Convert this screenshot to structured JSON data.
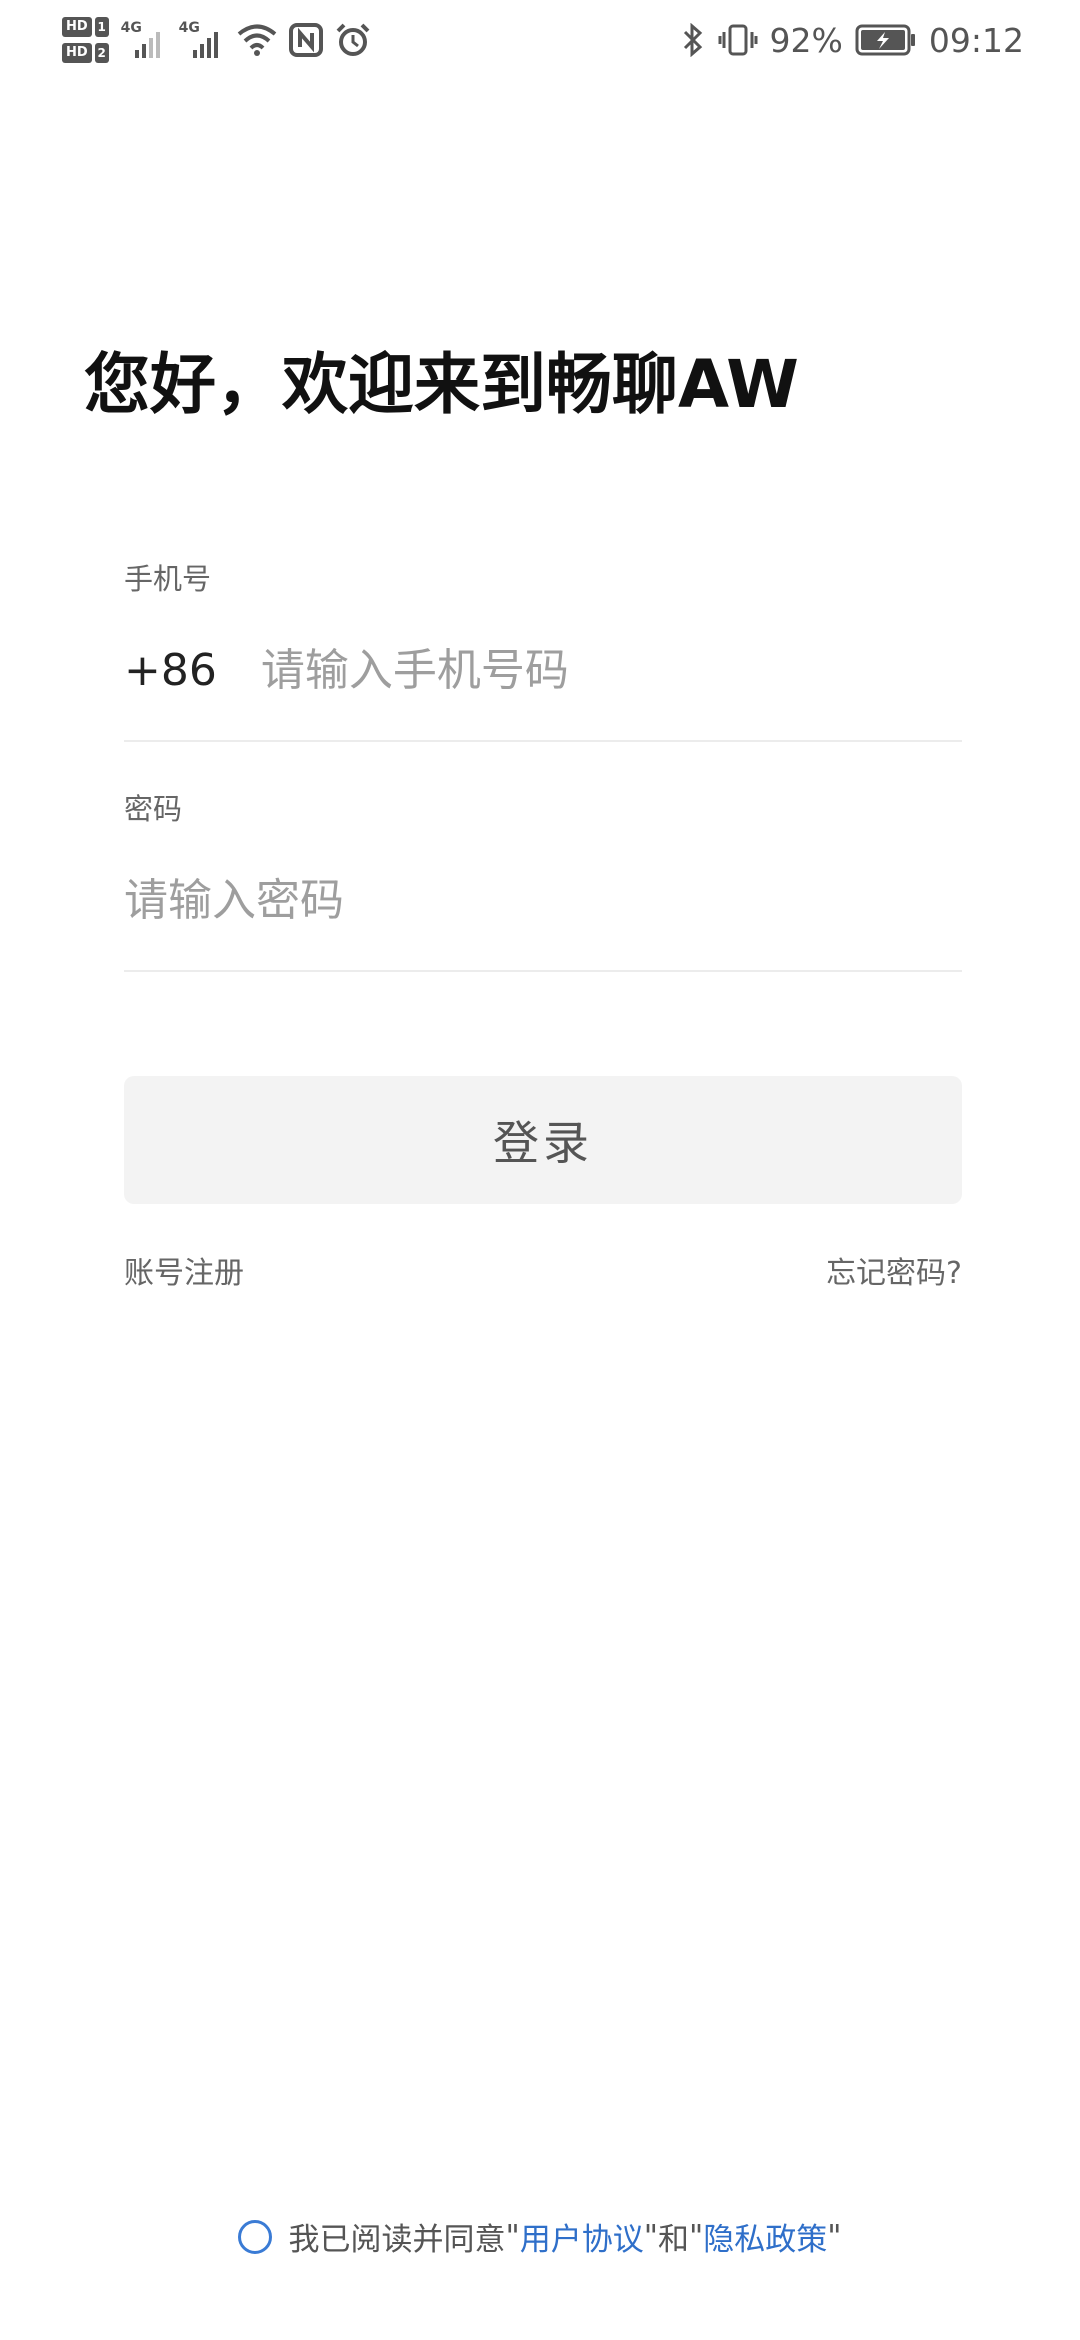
{
  "status_bar": {
    "hd1": "HD",
    "hd1_num": "1",
    "hd2": "HD",
    "hd2_num": "2",
    "net1": "4G",
    "net2": "4G",
    "battery_percent": "92%",
    "time": "09:12",
    "icons": [
      "signal-icon",
      "wifi-icon",
      "nfc-icon",
      "alarm-icon",
      "bluetooth-icon",
      "vibrate-icon",
      "battery-icon"
    ]
  },
  "title": "您好，欢迎来到畅聊AW",
  "phone": {
    "label": "手机号",
    "prefix": "+86",
    "placeholder": "请输入手机号码",
    "value": ""
  },
  "password": {
    "label": "密码",
    "placeholder": "请输入密码",
    "value": ""
  },
  "login_button": "登录",
  "register_link": "账号注册",
  "forgot_link": "忘记密码?",
  "agreement": {
    "prefix": "我已阅读并同意",
    "quote_open_1": "\"",
    "user_agreement": "用户协议",
    "quote_close_1": "\"",
    "and": "和",
    "quote_open_2": "\"",
    "privacy_policy": "隐私政策",
    "quote_close_2": "\"",
    "checked": false,
    "accent_color": "#2f6fc9"
  }
}
